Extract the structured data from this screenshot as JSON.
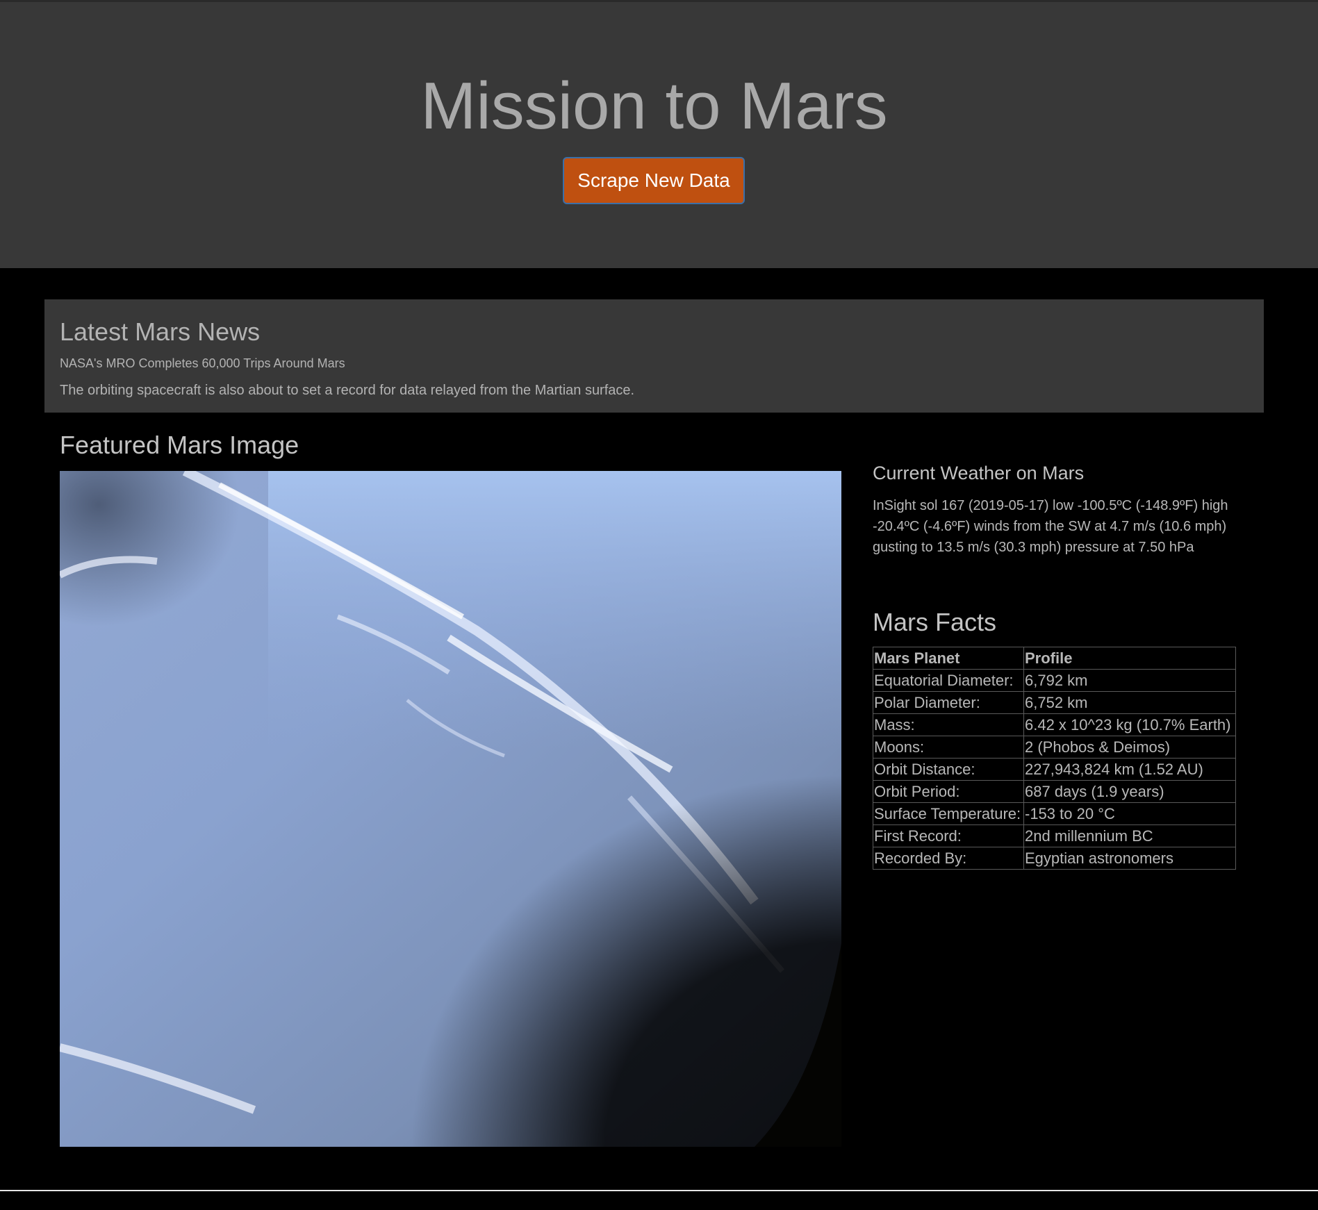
{
  "header": {
    "title": "Mission to Mars",
    "scrape_button_label": "Scrape New Data"
  },
  "news": {
    "heading": "Latest Mars News",
    "title": "NASA's MRO Completes 60,000 Trips Around Mars",
    "teaser": "The orbiting spacecraft is also about to set a record for data relayed from the Martian surface."
  },
  "featured": {
    "heading": "Featured Mars Image"
  },
  "weather": {
    "heading": "Current Weather on Mars",
    "text": "InSight sol 167 (2019-05-17) low -100.5ºC (-148.9ºF) high -20.4ºC (-4.6ºF) winds from the SW at 4.7 m/s (10.6 mph) gusting to 13.5 m/s (30.3 mph) pressure at 7.50 hPa"
  },
  "facts": {
    "heading": "Mars Facts",
    "columns": [
      "Mars Planet",
      "Profile"
    ],
    "rows": [
      [
        "Equatorial Diameter:",
        "6,792 km"
      ],
      [
        "Polar Diameter:",
        "6,752 km"
      ],
      [
        "Mass:",
        "6.42 x 10^23 kg (10.7% Earth)"
      ],
      [
        "Moons:",
        "2 (Phobos & Deimos)"
      ],
      [
        "Orbit Distance:",
        "227,943,824 km (1.52 AU)"
      ],
      [
        "Orbit Period:",
        "687 days (1.9 years)"
      ],
      [
        "Surface Temperature:",
        "-153 to 20 °C"
      ],
      [
        "First Record:",
        "2nd millennium BC"
      ],
      [
        "Recorded By:",
        "Egyptian astronomers"
      ]
    ]
  },
  "colors": {
    "header_bg": "#383838",
    "page_bg": "#000000",
    "button_bg": "#bf5010",
    "button_border": "#3b6fa8",
    "text": "#b8b8b8"
  }
}
